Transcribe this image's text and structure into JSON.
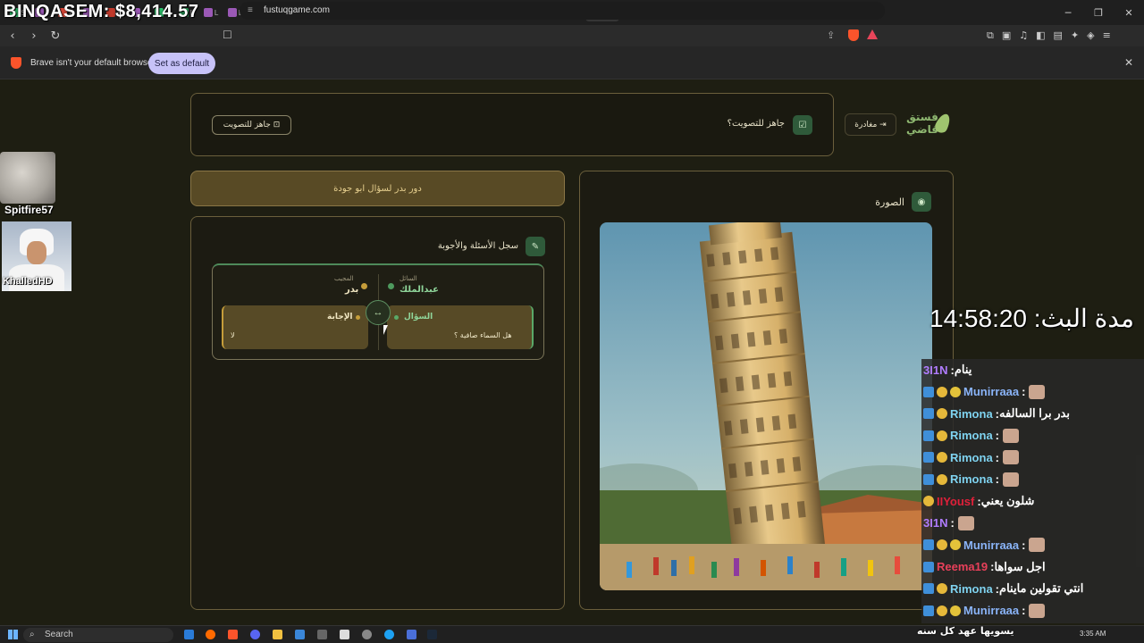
{
  "overlay": {
    "money_text": "BINQASEM: $8,414.57",
    "stream_timer": "مدة البث: 14:58:20",
    "cam1_name": "Spitfire57",
    "cam2_name": "KhalledHD"
  },
  "browser": {
    "tab_labels": [
      "S",
      "L",
      "B",
      "L",
      "N",
      "L",
      "S",
      "II",
      "L",
      "L",
      "L",
      "ر",
      "L",
      "ء",
      "L",
      "II",
      "L",
      "S",
      "ء",
      "L",
      "N",
      "S",
      "C",
      "S",
      "ء"
    ],
    "url": "fustuqgame.com",
    "infobar_text": "Brave isn't your default browser",
    "set_default_label": "Set as default"
  },
  "page": {
    "logo_text": "فستق قاضي",
    "leave_label": "مغادرة",
    "vote_ready_title": "جاهز للتصويت؟",
    "vote_ready_button": "جاهز للتصويت",
    "turn_banner": "دور بدر لسؤال ابو جودة",
    "qa_title": "سجل الأسئلة والأجوبة",
    "asker_role": "السائل",
    "asker_name": "عبدالملك",
    "answerer_role": "المجيب",
    "answerer_name": "بدر",
    "question_title": "السؤال",
    "question_text": "هل السماء صافية ؟",
    "answer_title": "الإجابة",
    "answer_text": "لا",
    "image_title": "الصورة"
  },
  "chat": [
    {
      "user": "3I1N",
      "msg": "ينام",
      "color": "#b07cff",
      "badges": [],
      "emote": false
    },
    {
      "user": "Munirraaa",
      "msg": "",
      "color": "#8ab4f8",
      "badges": [
        "blue",
        "coin",
        "num"
      ],
      "emote": true
    },
    {
      "user": "Rimona",
      "msg": "بدر برا السالفه",
      "color": "#7fd3f0",
      "badges": [
        "blue",
        "coin"
      ],
      "emote": false
    },
    {
      "user": "Rimona",
      "msg": "",
      "color": "#7fd3f0",
      "badges": [
        "blue",
        "coin"
      ],
      "emote": true
    },
    {
      "user": "Rimona",
      "msg": "",
      "color": "#7fd3f0",
      "badges": [
        "blue",
        "coin"
      ],
      "emote": true
    },
    {
      "user": "Rimona",
      "msg": "",
      "color": "#7fd3f0",
      "badges": [
        "blue",
        "coin"
      ],
      "emote": true
    },
    {
      "user": "IIYousf",
      "msg": "شلون يعني",
      "color": "#e0203a",
      "badges": [
        "coin"
      ],
      "emote": false
    },
    {
      "user": "3I1N",
      "msg": "",
      "color": "#b07cff",
      "badges": [],
      "emote": true
    },
    {
      "user": "Munirraaa",
      "msg": "",
      "color": "#8ab4f8",
      "badges": [
        "blue",
        "coin",
        "num"
      ],
      "emote": true
    },
    {
      "user": "Reema19",
      "msg": "اجل سواها",
      "color": "#e8405a",
      "badges": [
        "blue"
      ],
      "emote": false
    },
    {
      "user": "Rimona",
      "msg": "انتي تقولين ماينام",
      "color": "#7fd3f0",
      "badges": [
        "blue",
        "coin"
      ],
      "emote": false
    },
    {
      "user": "Munirraaa",
      "msg": "",
      "color": "#8ab4f8",
      "badges": [
        "blue",
        "coin",
        "num"
      ],
      "emote": true
    }
  ],
  "taskbar": {
    "search_label": "Search",
    "time": "3:35 AM",
    "bottom_overlay_text": "يسويها عهد كل سنه"
  }
}
